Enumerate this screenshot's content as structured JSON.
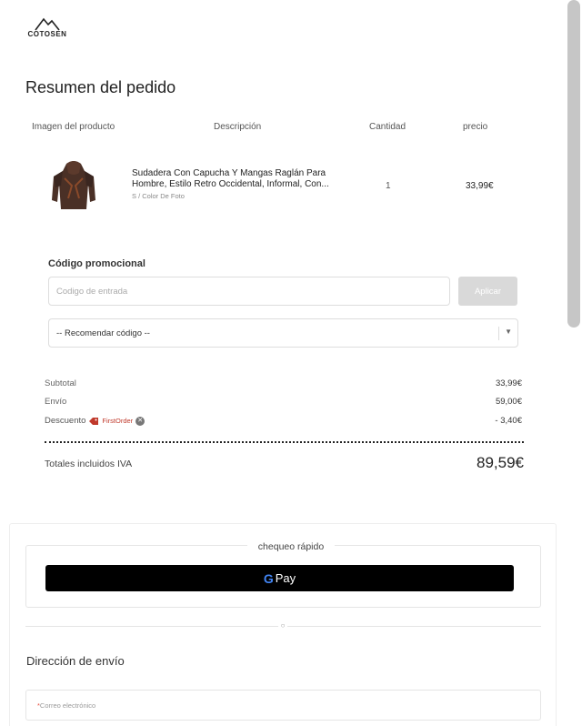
{
  "brand": {
    "name": "COTOSEN"
  },
  "order_summary": {
    "title": "Resumen del pedido",
    "columns": [
      "Imagen del producto",
      "Descripción",
      "Cantidad",
      "precio"
    ],
    "product": {
      "name": "Sudadera Con Capucha Y Mangas Raglán Para Hombre, Estilo Retro Occidental, Informal, Con...",
      "variant": "S / Color De Foto",
      "quantity": "1",
      "price": "33,99€"
    }
  },
  "promo": {
    "title": "Código promocional",
    "input_placeholder": "Codigo de entrada",
    "apply_label": "Aplicar",
    "recommend_label": "-- Recomendar código --"
  },
  "totals": {
    "subtotal_label": "Subtotal",
    "subtotal_value": "33,99€",
    "shipping_label": "Envío",
    "shipping_value": "59,00€",
    "discount_label": "Descuento",
    "coupon_code": "FirstOrder",
    "discount_value": "- 3,40€",
    "total_label": "Totales incluidos IVA",
    "total_value": "89,59€"
  },
  "checkout": {
    "quick_label": "chequeo rápido",
    "gpay_label": "Pay",
    "shipping_title": "Dirección de envío",
    "email_label": "Correo electrónico"
  },
  "colors": {
    "coupon": "#c0392b",
    "apply_disabled": "#d9d9d9",
    "gpay_bg": "#000000"
  }
}
